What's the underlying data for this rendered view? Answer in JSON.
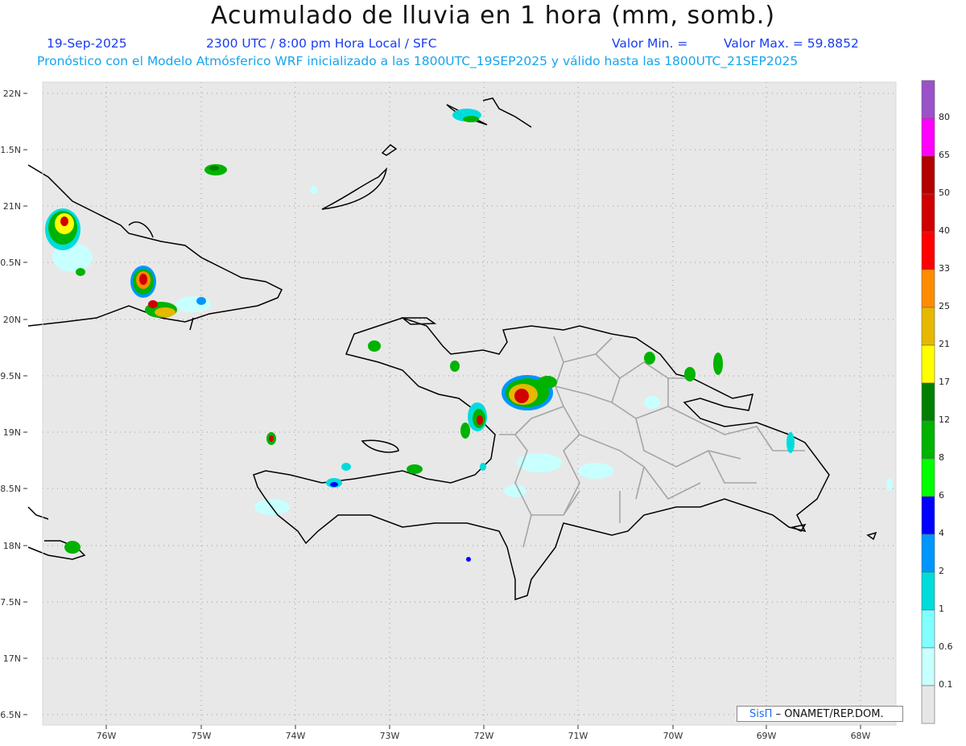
{
  "header": {
    "title": "Acumulado de lluvia en 1 hora (mm, somb.)",
    "date": "19-Sep-2025",
    "time_info": "2300 UTC / 8:00 pm Hora Local / SFC",
    "min_label": "Valor Min. =",
    "max_label": "Valor Max. = 59.8852",
    "model_info": "Pronóstico con el Modelo Atmósferico WRF inicializado a las 1800UTC_19SEP2025 y válido hasta las  1800UTC_21SEP2025"
  },
  "map": {
    "lat_labels": [
      "22N",
      "1.5N",
      "21N",
      "0.5N",
      "20N",
      "9.5N",
      "19N",
      "8.5N",
      "18N",
      "7.5N",
      "17N",
      "6.5N"
    ],
    "lon_labels": [
      "76W",
      "75W",
      "74W",
      "73W",
      "72W",
      "71W",
      "70W",
      "69W",
      "68W"
    ],
    "background_color": "#e8e8e8",
    "coast_color": "#000000",
    "province_border_color": "#a0a0a0"
  },
  "colorbar": {
    "tick_labels": [
      "80",
      "65",
      "50",
      "40",
      "33",
      "25",
      "21",
      "17",
      "12",
      "8",
      "6",
      "4",
      "2",
      "1",
      "0.6",
      "0.1"
    ],
    "colors": [
      "#9a52c8",
      "#ff00ff",
      "#b30000",
      "#d00000",
      "#ff0000",
      "#ff8c00",
      "#e6b800",
      "#ffff00",
      "#008000",
      "#00b300",
      "#00ff00",
      "#0000ff",
      "#0096ff",
      "#00dcdc",
      "#80ffff",
      "#c8ffff",
      "#e6e6e6"
    ]
  },
  "credit": {
    "logo_text": "SisΠ",
    "text": "– ONAMET/REP.DOM."
  }
}
